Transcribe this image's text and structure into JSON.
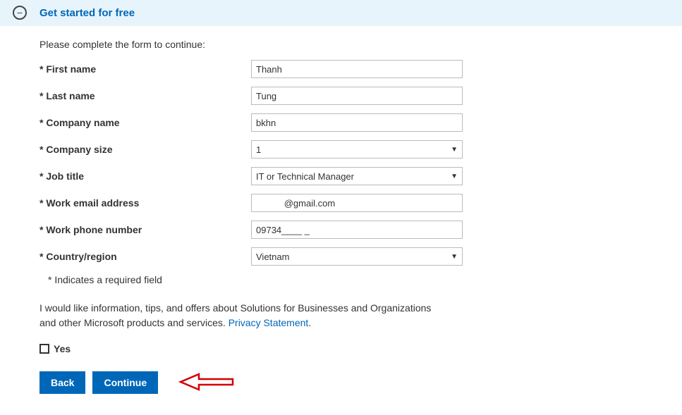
{
  "header": {
    "title": "Get started for free"
  },
  "form": {
    "instruction": "Please complete the form to continue:",
    "fields": {
      "first_name": {
        "label": "* First name",
        "value": "Thanh"
      },
      "last_name": {
        "label": "* Last name",
        "value": "Tung"
      },
      "company_name": {
        "label": "* Company name",
        "value": "bkhn"
      },
      "company_size": {
        "label": "* Company size",
        "value": "1"
      },
      "job_title": {
        "label": "* Job title",
        "value": "IT or Technical Manager"
      },
      "work_email": {
        "label": "* Work email address",
        "value": "           @gmail.com"
      },
      "work_phone": {
        "label": "* Work phone number",
        "value": "09734____ _"
      },
      "country": {
        "label": "* Country/region",
        "value": "Vietnam"
      }
    },
    "required_note": "* Indicates a required field",
    "consent_text_a": "I would like information, tips, and offers about Solutions for Businesses and Organizations and other Microsoft products and services. ",
    "privacy_link": "Privacy Statement",
    "consent_text_b": ".",
    "yes_label": "Yes"
  },
  "buttons": {
    "back": "Back",
    "continue": "Continue"
  }
}
